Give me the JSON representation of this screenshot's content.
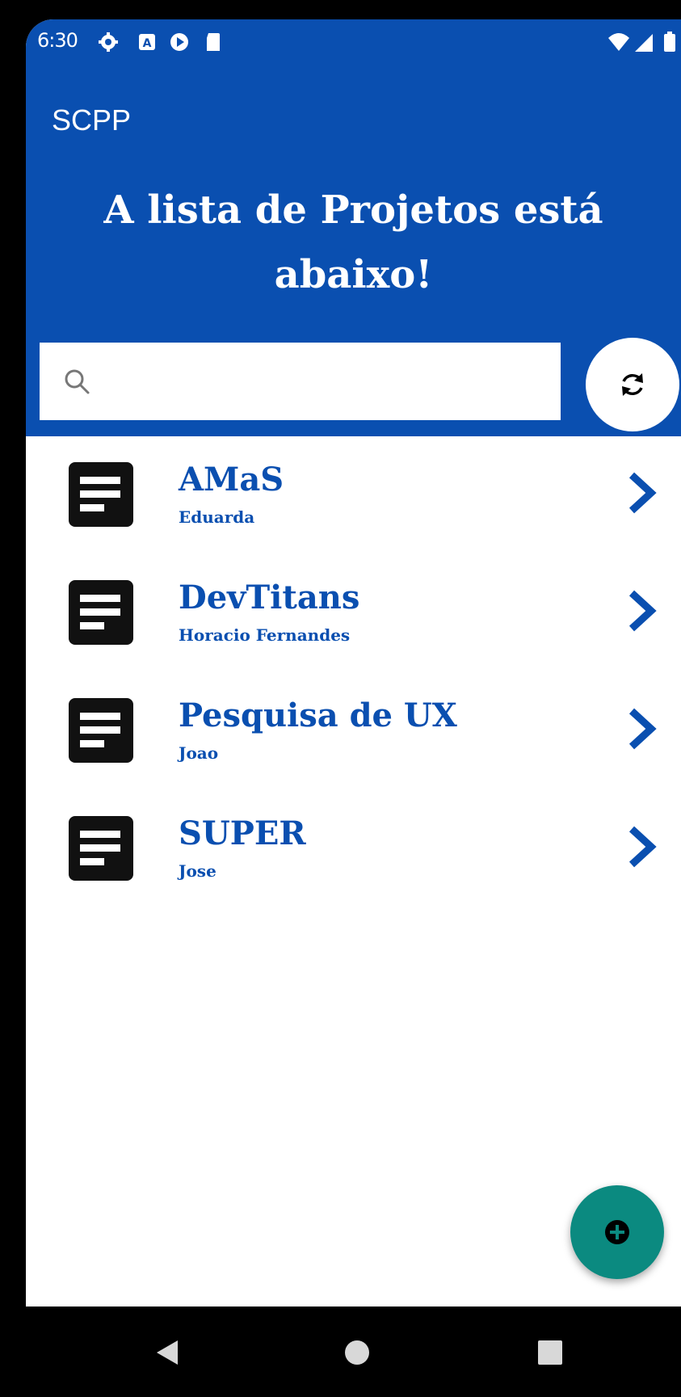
{
  "status_bar": {
    "time": "6:30",
    "left_icons": [
      "settings-icon",
      "a-box-icon",
      "play-protect-icon",
      "sd-card-icon"
    ],
    "right_icons": [
      "wifi-icon",
      "signal-icon",
      "battery-icon"
    ]
  },
  "app_bar": {
    "title": "SCPP"
  },
  "header": {
    "headline": "A lista de Projetos está abaixo!",
    "search_placeholder": "",
    "search_value": ""
  },
  "projects": [
    {
      "title": "AMaS",
      "owner": "Eduarda"
    },
    {
      "title": "DevTitans",
      "owner": "Horacio Fernandes"
    },
    {
      "title": "Pesquisa de UX",
      "owner": "Joao"
    },
    {
      "title": "SUPER",
      "owner": "Jose"
    }
  ],
  "colors": {
    "primary": "#0a4fb0",
    "fab": "#0b8a80",
    "text_on_primary": "#ffffff"
  }
}
